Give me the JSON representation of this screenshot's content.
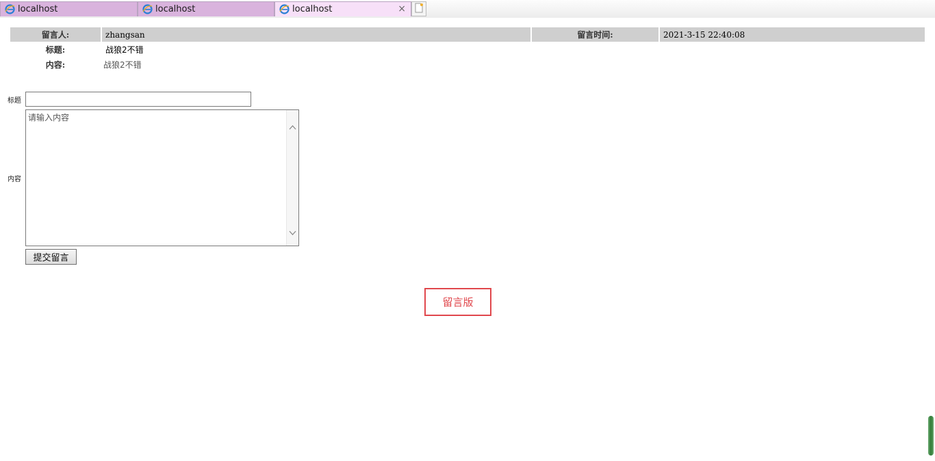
{
  "browser": {
    "tabs": [
      {
        "label": "localhost",
        "active": false
      },
      {
        "label": "localhost",
        "active": false
      },
      {
        "label": "localhost",
        "active": true
      }
    ],
    "close_glyph": "×"
  },
  "message": {
    "author_label": "留言人:",
    "author_value": "zhangsan",
    "time_label": "留言时间:",
    "time_value": "2021-3-15 22:40:08",
    "title_label": "标题:",
    "title_value": "战狼2不错",
    "content_label": "内容:",
    "content_value": "战狼2不错"
  },
  "form": {
    "title_label": "标题",
    "title_value": "",
    "content_label": "内容",
    "content_placeholder": "请输入内容",
    "submit_label": "提交留言"
  },
  "board": {
    "label": "留言版",
    "color": "#e0474c"
  },
  "colors": {
    "tab_bg": "#d9b3dd",
    "tab_active_bg": "#f7e0f8",
    "header_cell_bg": "#cfcfcf"
  }
}
